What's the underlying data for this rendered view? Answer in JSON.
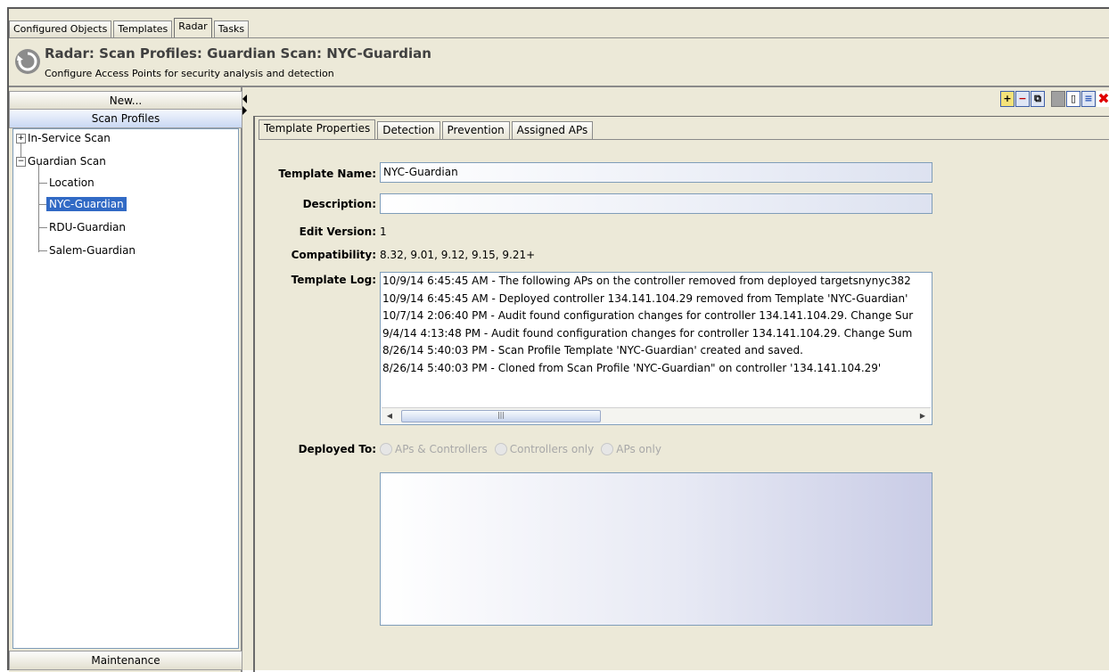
{
  "top_tabs": [
    "Configured Objects",
    "Templates",
    "Radar",
    "Tasks"
  ],
  "header": {
    "title": "Radar: Scan Profiles: Guardian Scan: NYC-Guardian",
    "subtitle": "Configure Access Points for security analysis and detection"
  },
  "left": {
    "new_button": "New...",
    "section": "Scan Profiles",
    "tree": {
      "in_service": "In-Service Scan",
      "guardian": "Guardian Scan",
      "location": "Location",
      "nyc": "NYC-Guardian",
      "rdu": "RDU-Guardian",
      "salem": "Salem-Guardian"
    },
    "maintenance": "Maintenance"
  },
  "tabs": [
    "Template Properties",
    "Detection",
    "Prevention",
    "Assigned APs"
  ],
  "form": {
    "template_name_label": "Template Name:",
    "template_name_value": "NYC-Guardian",
    "description_label": "Description:",
    "description_value": "",
    "edit_version_label": "Edit Version:",
    "edit_version_value": "1",
    "compatibility_label": "Compatibility:",
    "compatibility_value": "8.32, 9.01, 9.12, 9.15, 9.21+",
    "template_log_label": "Template Log:",
    "log": [
      "10/9/14 6:45:45 AM - The following APs on the controller removed from deployed targetsnynyc382",
      "10/9/14 6:45:45 AM - Deployed controller 134.141.104.29 removed from Template 'NYC-Guardian'",
      "10/7/14 2:06:40 PM - Audit found configuration changes for controller 134.141.104.29. Change Sur",
      "9/4/14 4:13:48 PM - Audit found configuration changes for controller 134.141.104.29. Change Sum",
      "8/26/14 5:40:03 PM - Scan Profile Template 'NYC-Guardian' created and saved.",
      "8/26/14 5:40:03 PM - Cloned from Scan Profile 'NYC-Guardian\" on controller '134.141.104.29'"
    ],
    "deployed_to_label": "Deployed To:",
    "deployed_options": [
      "APs & Controllers",
      "Controllers only",
      "APs only"
    ]
  },
  "toolbar_icons": [
    "add-template-icon",
    "remove-template-icon",
    "copy-icon",
    "disabled-icon",
    "new-document-icon",
    "collapse-icon",
    "delete-icon"
  ],
  "colors": {
    "background": "#ece9d8",
    "selection": "#316ac5",
    "field_border": "#7f9db9"
  }
}
